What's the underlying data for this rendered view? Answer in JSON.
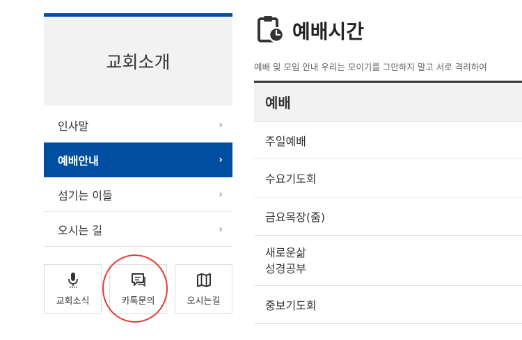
{
  "sidebar": {
    "title": "교회소개",
    "items": [
      {
        "label": "인사말",
        "active": false
      },
      {
        "label": "예배안내",
        "active": true
      },
      {
        "label": "섬기는 이들",
        "active": false
      },
      {
        "label": "오시는 길",
        "active": false
      }
    ],
    "quick_links": [
      {
        "label": "교회소식",
        "icon": "microphone-icon"
      },
      {
        "label": "카톡문의",
        "icon": "chat-bubble-icon"
      },
      {
        "label": "오시는길",
        "icon": "map-icon"
      }
    ]
  },
  "main": {
    "title": "예배시간",
    "title_icon": "clipboard-clock-icon",
    "subtitle": "예배 및 모임 안내 우리는 모이기를 그만하지 말고 서로 격려하여",
    "table": {
      "header": "예배",
      "rows": [
        {
          "line1": "주일예배"
        },
        {
          "line1": "수요기도회"
        },
        {
          "line1": "금요목장(줌)"
        },
        {
          "line1": "새로운삶",
          "line2": "성경공부"
        },
        {
          "line1": "중보기도회"
        }
      ]
    }
  },
  "colors": {
    "accent": "#004ea2",
    "highlight_ring": "#e53935",
    "panel_bg": "#f2f2f2"
  }
}
